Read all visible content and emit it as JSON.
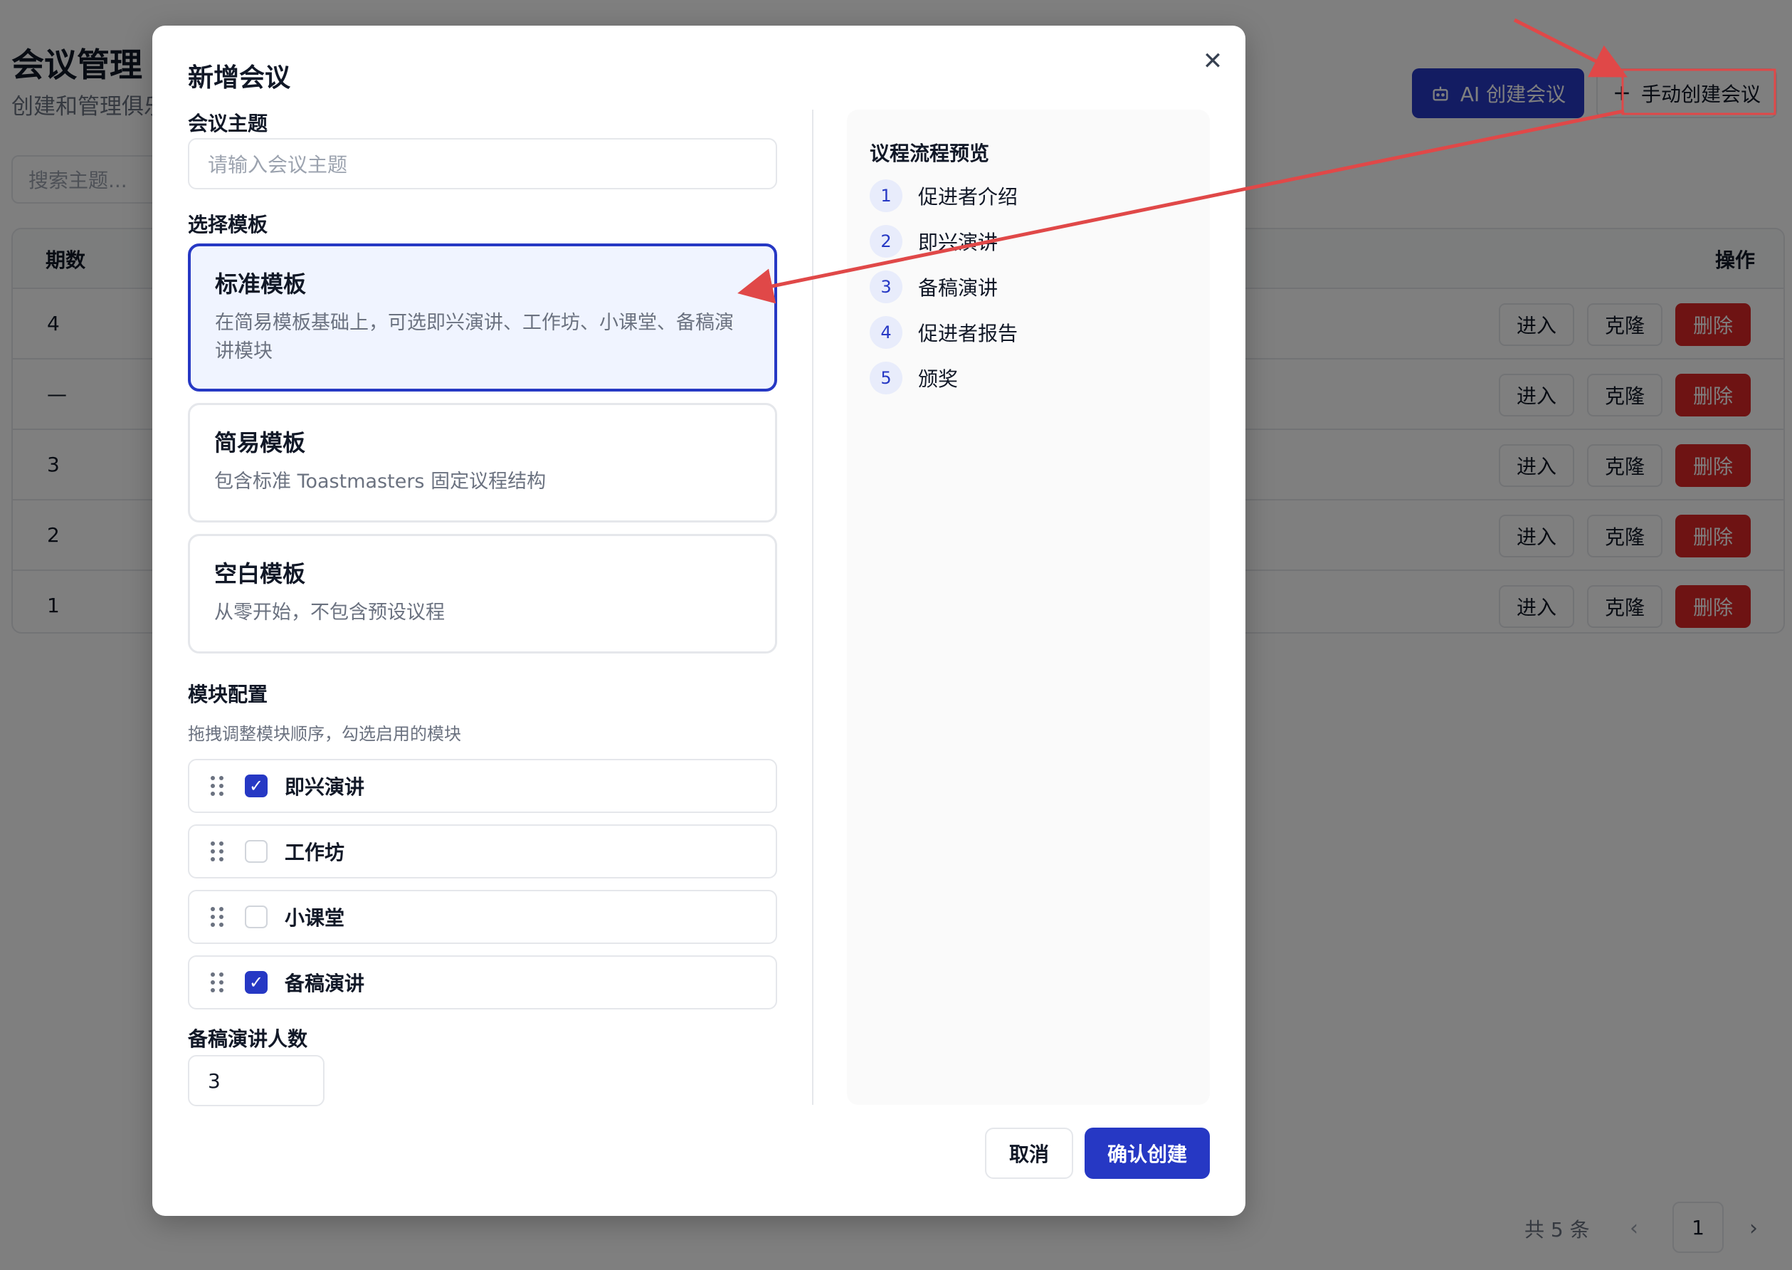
{
  "page": {
    "title": "会议管理",
    "subtitle": "创建和管理俱乐",
    "ai_button_label": "AI 创建会议",
    "manual_button_label": "手动创建会议",
    "search_placeholder": "搜索主题...",
    "table_headers": {
      "number": "期数",
      "actions": "操作"
    },
    "rows": [
      {
        "number": "4"
      },
      {
        "number": "—"
      },
      {
        "number": "3"
      },
      {
        "number": "2"
      },
      {
        "number": "1"
      }
    ],
    "row_actions": {
      "enter": "进入",
      "clone": "克隆",
      "delete": "删除"
    },
    "pagination": {
      "total": "共 5 条",
      "current": "1"
    }
  },
  "modal": {
    "title": "新增会议",
    "topic_label": "会议主题",
    "topic_placeholder": "请输入会议主题",
    "template_label": "选择模板",
    "templates": [
      {
        "name": "标准模板",
        "desc": "在简易模板基础上，可选即兴演讲、工作坊、小课堂、备稿演讲模块",
        "selected": true
      },
      {
        "name": "简易模板",
        "desc": "包含标准 Toastmasters 固定议程结构",
        "selected": false
      },
      {
        "name": "空白模板",
        "desc": "从零开始，不包含预设议程",
        "selected": false
      }
    ],
    "module_label": "模块配置",
    "module_hint": "拖拽调整模块顺序，勾选启用的模块",
    "modules": [
      {
        "label": "即兴演讲",
        "checked": true
      },
      {
        "label": "工作坊",
        "checked": false
      },
      {
        "label": "小课堂",
        "checked": false
      },
      {
        "label": "备稿演讲",
        "checked": true
      }
    ],
    "speaker_count_label": "备稿演讲人数",
    "speaker_count_value": "3",
    "preview_title": "议程流程预览",
    "preview_steps": [
      {
        "num": "1",
        "text": "促进者介绍"
      },
      {
        "num": "2",
        "text": "即兴演讲"
      },
      {
        "num": "3",
        "text": "备稿演讲"
      },
      {
        "num": "4",
        "text": "促进者报告"
      },
      {
        "num": "5",
        "text": "颁奖"
      }
    ],
    "cancel_label": "取消",
    "confirm_label": "确认创建"
  },
  "colors": {
    "primary": "#2638c4",
    "danger": "#dc2626",
    "annotation": "#e04848",
    "overlay": "rgba(0,0,0,0.5)"
  },
  "icons": [
    "robot-icon",
    "plus-icon",
    "close-icon",
    "drag-handle-icon",
    "checkmark-icon",
    "chevron-left-icon",
    "chevron-right-icon"
  ]
}
